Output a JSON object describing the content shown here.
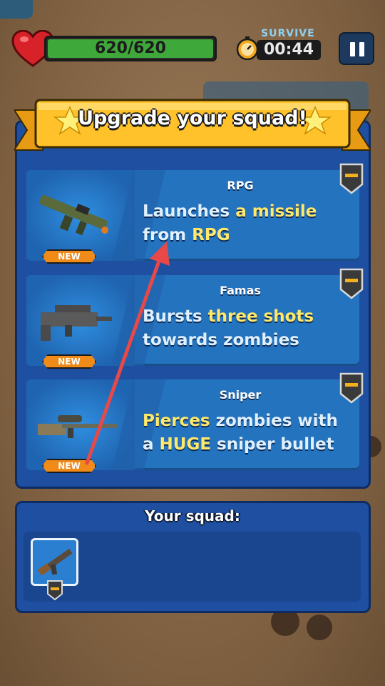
{
  "hud": {
    "health_text": "620/620",
    "health_fraction": 1.0,
    "survive_label": "SURVIVE",
    "timer": "00:44",
    "heart_icon": "heart-icon",
    "timer_icon": "stopwatch-icon",
    "pause_icon": "pause-icon"
  },
  "upgrade_panel": {
    "title": "Upgrade your squad!",
    "cards": [
      {
        "name": "RPG",
        "badge": "NEW",
        "desc_parts": [
          {
            "text": "Launches ",
            "highlight": false
          },
          {
            "text": "a missile",
            "highlight": true
          },
          {
            "text": " from ",
            "highlight": false
          },
          {
            "text": "RPG",
            "highlight": true
          }
        ],
        "icon": "rpg-icon"
      },
      {
        "name": "Famas",
        "badge": "NEW",
        "desc_parts": [
          {
            "text": "Bursts ",
            "highlight": false
          },
          {
            "text": "three shots",
            "highlight": true
          },
          {
            "text": " towards zombies",
            "highlight": false
          }
        ],
        "icon": "famas-icon"
      },
      {
        "name": "Sniper",
        "badge": "NEW",
        "desc_parts": [
          {
            "text": "Pierces",
            "highlight": true
          },
          {
            "text": " zombies with a ",
            "highlight": false
          },
          {
            "text": "HUGE",
            "highlight": true
          },
          {
            "text": " sniper bullet",
            "highlight": false
          }
        ],
        "icon": "sniper-icon"
      }
    ]
  },
  "squad": {
    "title": "Your squad:",
    "slots": [
      {
        "icon": "ak-rifle-icon"
      }
    ]
  },
  "colors": {
    "panel": "#1e4fa0",
    "card": "#2473be",
    "highlight": "#ffe86a",
    "ribbon": "#ffc22a",
    "badge": "#f08a18",
    "health": "#3fa83a"
  }
}
